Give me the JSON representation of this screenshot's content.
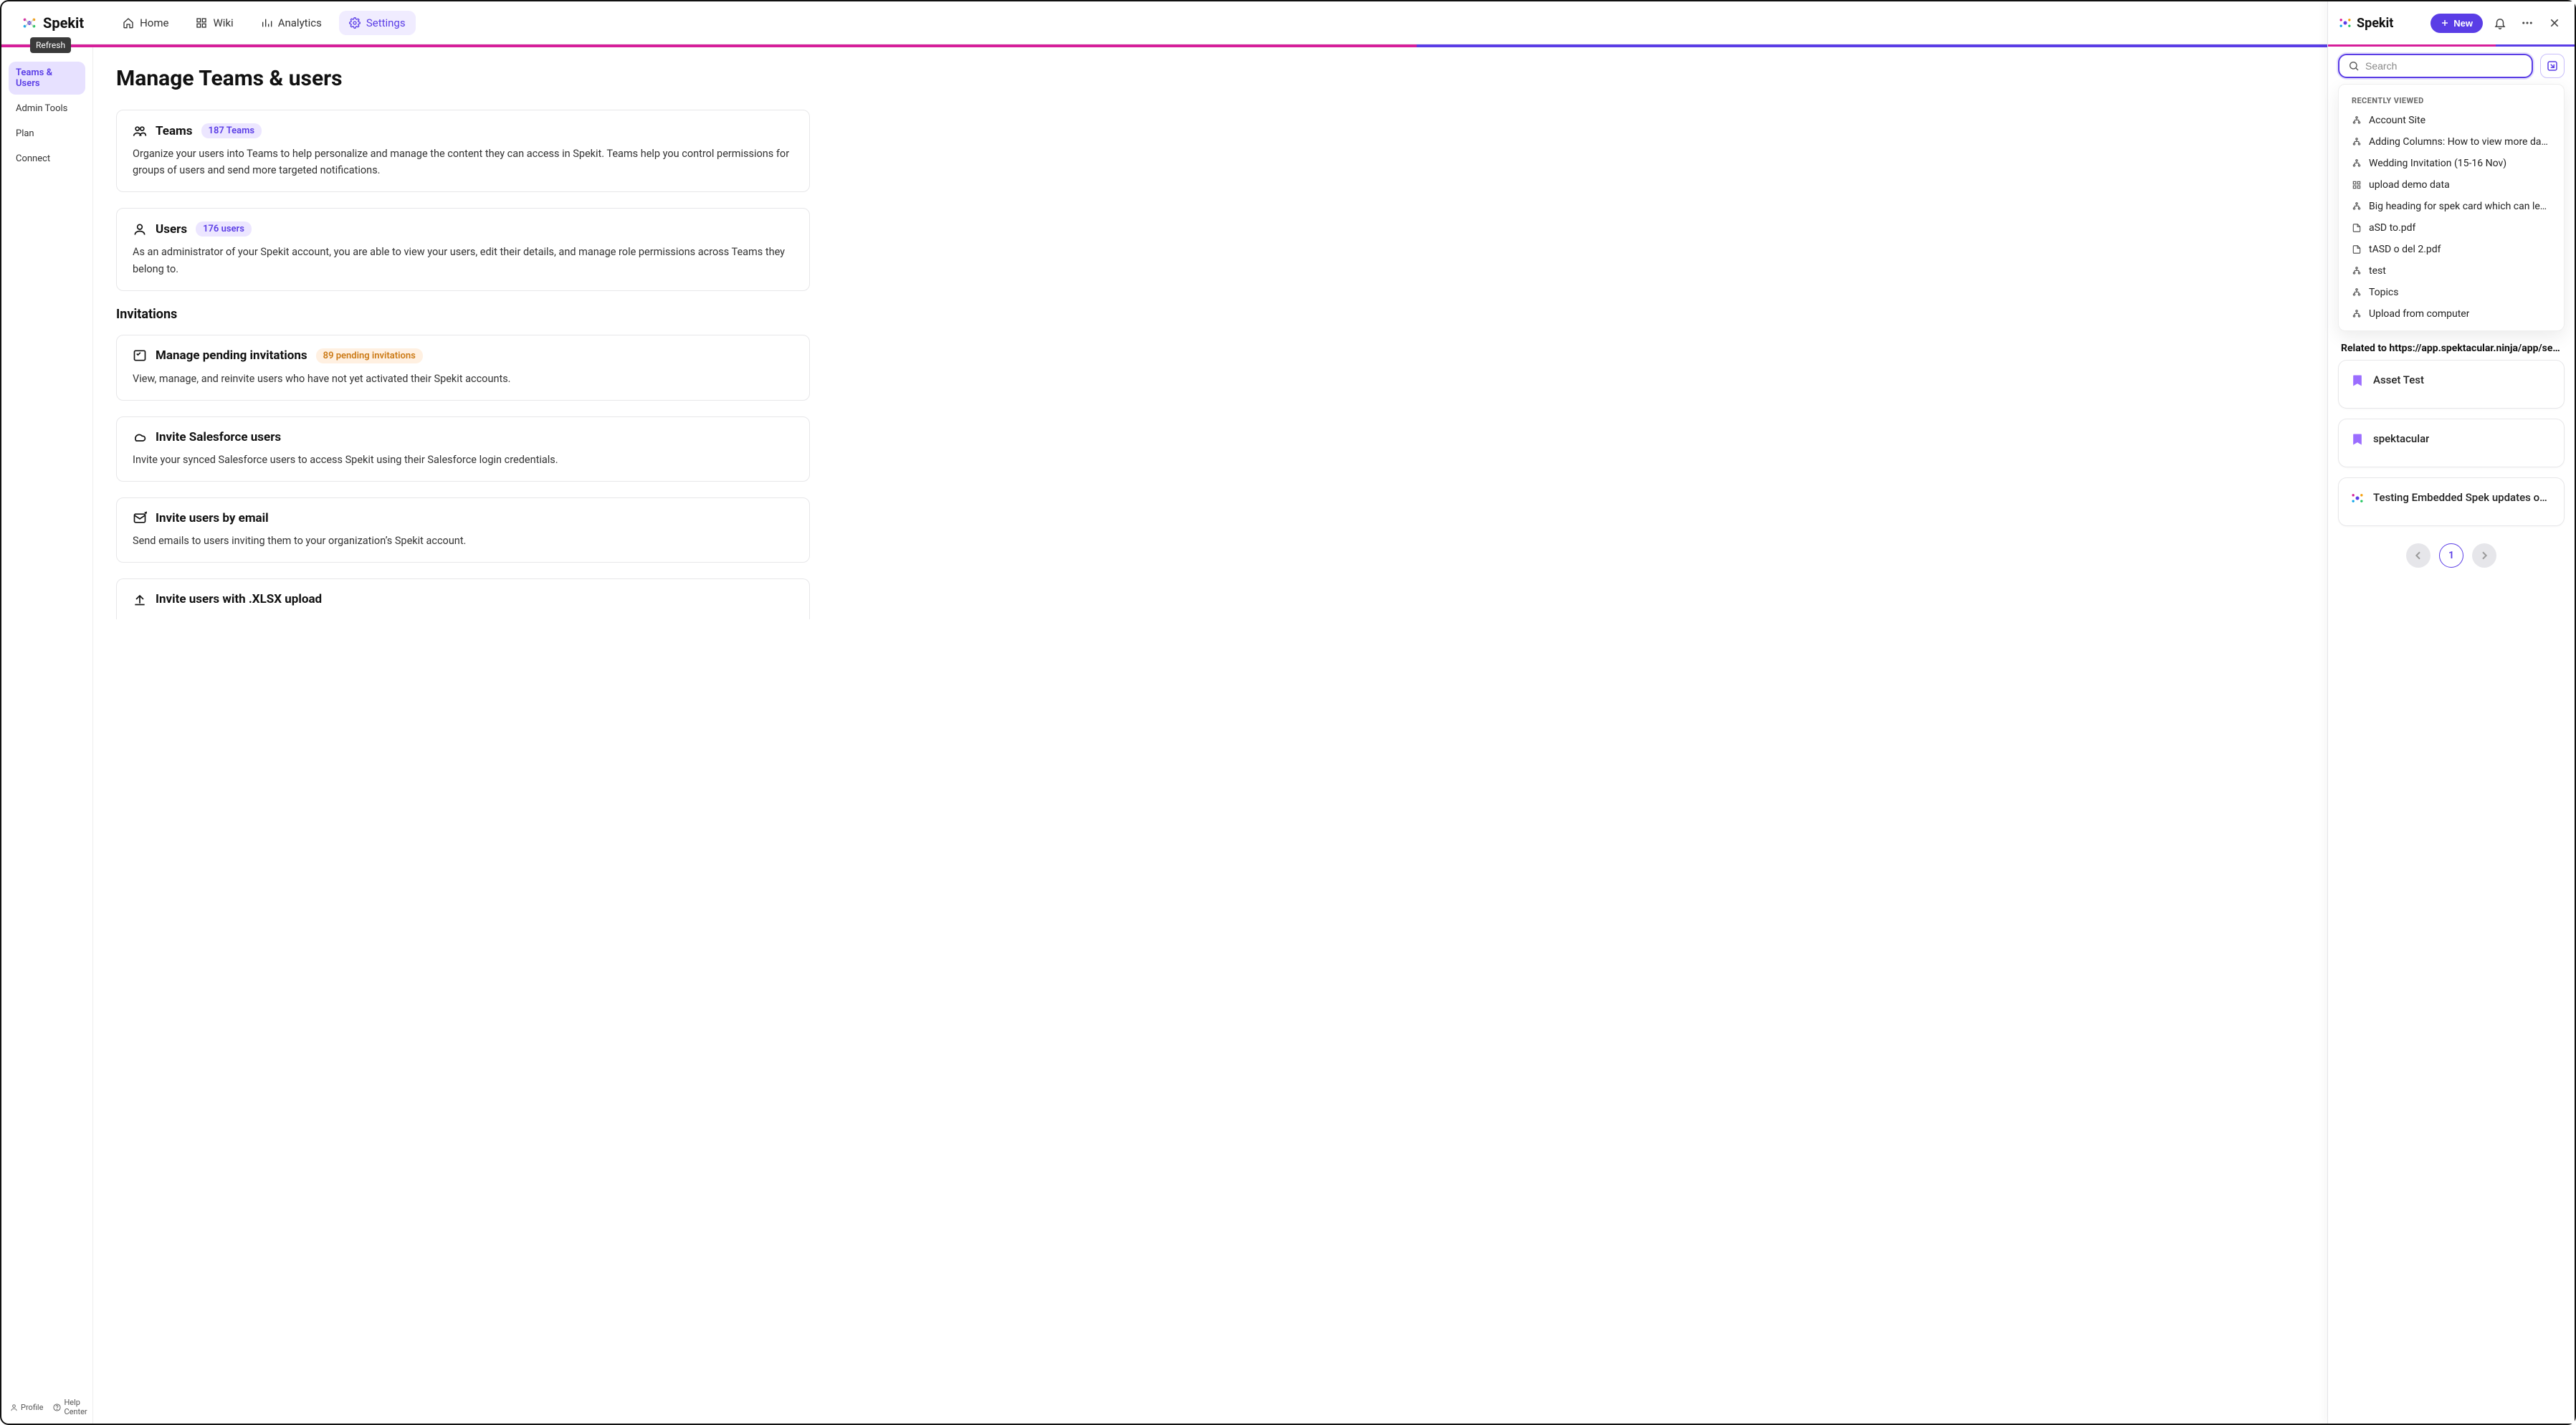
{
  "brand": {
    "name": "Spekit",
    "tooltip": "Refresh"
  },
  "nav": {
    "home": "Home",
    "wiki": "Wiki",
    "analytics": "Analytics",
    "settings": "Settings"
  },
  "search": {
    "placeholder": "Search"
  },
  "sidebar": {
    "items": [
      {
        "label": "Teams & Users"
      },
      {
        "label": "Admin Tools"
      },
      {
        "label": "Plan"
      },
      {
        "label": "Connect"
      }
    ],
    "footer": {
      "profile": "Profile",
      "help": "Help Center"
    }
  },
  "page": {
    "title": "Manage Teams & users",
    "teams": {
      "title": "Teams",
      "pill": "187 Teams",
      "desc": "Organize your users into Teams to help personalize and manage the content they can access in Spekit. Teams help you control permissions for groups of users and send more targeted notifications."
    },
    "users": {
      "title": "Users",
      "pill": "176 users",
      "desc": "As an administrator of your Spekit account, you are able to view your users, edit their details, and manage role permissions across Teams they belong to."
    },
    "invitations_section_title": "Invitations",
    "pending": {
      "title": "Manage pending invitations",
      "pill": "89 pending invitations",
      "desc": "View, manage, and reinvite users who have not yet activated their Spekit accounts."
    },
    "salesforce": {
      "title": "Invite Salesforce users",
      "desc": "Invite your synced Salesforce users to access Spekit using their Salesforce login credentials."
    },
    "email": {
      "title": "Invite users by email",
      "desc": "Send emails to users inviting them to your organization’s Spekit account."
    },
    "xlsx": {
      "title": "Invite users with .XLSX upload"
    }
  },
  "panel": {
    "brand": "Spekit",
    "new_label": "New",
    "search_placeholder": "Search",
    "recently_viewed_header": "RECENTLY VIEWED",
    "recent_items": [
      {
        "icon": "org",
        "label": "Account Site"
      },
      {
        "icon": "org",
        "label": "Adding Columns: How to view more data …"
      },
      {
        "icon": "org",
        "label": "Wedding Invitation (15-16 Nov)"
      },
      {
        "icon": "grid",
        "label": "upload demo data"
      },
      {
        "icon": "org",
        "label": "Big heading for spek card which can lead …"
      },
      {
        "icon": "file",
        "label": "aSD to.pdf"
      },
      {
        "icon": "file",
        "label": "tASD o del 2.pdf"
      },
      {
        "icon": "org",
        "label": "test"
      },
      {
        "icon": "org",
        "label": "Topics"
      },
      {
        "icon": "org",
        "label": "Upload from computer"
      }
    ],
    "related_label": "Related to https://app.spektacular.ninja/app/settings…",
    "related_cards": [
      {
        "icon": "bookmark",
        "title": "Asset Test"
      },
      {
        "icon": "bookmark",
        "title": "spektacular"
      },
      {
        "icon": "brand",
        "title": "Testing Embedded Spek updates on St…"
      }
    ],
    "page_number": "1"
  }
}
